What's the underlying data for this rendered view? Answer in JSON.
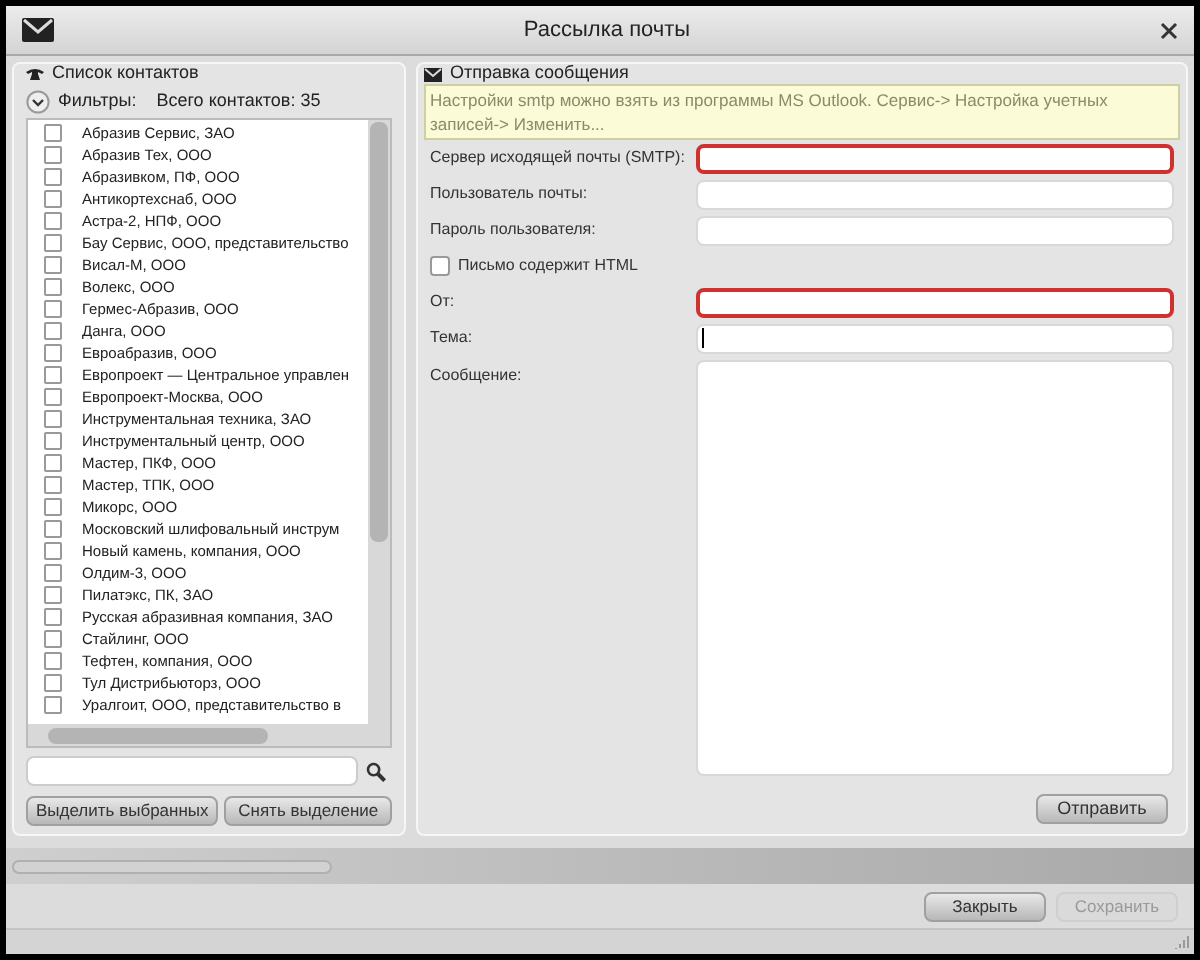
{
  "window": {
    "title": "Рассылка почты"
  },
  "contacts_panel": {
    "title": "Список контактов",
    "filters_label": "Фильтры:",
    "total": "Всего контактов: 35",
    "items": [
      {
        "label": "Абразив Сервис, ЗАО",
        "checked": false
      },
      {
        "label": "Абразив Тех, ООО",
        "checked": false
      },
      {
        "label": "Абразивком, ПФ, ООО",
        "checked": false
      },
      {
        "label": "Антикортехснаб, ООО",
        "checked": false
      },
      {
        "label": "Астра-2, НПФ, ООО",
        "checked": false
      },
      {
        "label": "Бау Сервис, ООО, представительство",
        "checked": false
      },
      {
        "label": "Висал-М, ООО",
        "checked": false
      },
      {
        "label": "Волекс, ООО",
        "checked": false
      },
      {
        "label": "Гермес-Абразив, ООО",
        "checked": false
      },
      {
        "label": "Данга, ООО",
        "checked": false
      },
      {
        "label": "Евроабразив, ООО",
        "checked": false
      },
      {
        "label": "Европроект — Центральное управлен",
        "checked": false
      },
      {
        "label": "Европроект-Москва, ООО",
        "checked": false
      },
      {
        "label": "Инструментальная техника, ЗАО",
        "checked": false
      },
      {
        "label": "Инструментальный центр, ООО",
        "checked": false
      },
      {
        "label": "Мастер, ПКФ, ООО",
        "checked": false
      },
      {
        "label": "Мастер, ТПК, ООО",
        "checked": false
      },
      {
        "label": "Микорс, ООО",
        "checked": false
      },
      {
        "label": "Московский шлифовальный инструм",
        "checked": false
      },
      {
        "label": "Новый камень, компания, ООО",
        "checked": false
      },
      {
        "label": "Олдим-3, ООО",
        "checked": false
      },
      {
        "label": "Пилатэкс, ПК, ЗАО",
        "checked": false
      },
      {
        "label": "Русская абразивная компания, ЗАО",
        "checked": false
      },
      {
        "label": "Стайлинг, ООО",
        "checked": false
      },
      {
        "label": "Тефтен, компания, ООО",
        "checked": false
      },
      {
        "label": "Тул Дистрибьюторз, ООО",
        "checked": false
      },
      {
        "label": "Уралгоит, ООО, представительство в",
        "checked": false
      }
    ],
    "buttons": [
      "Выделить выбранных",
      "Снять выделение"
    ]
  },
  "message_panel": {
    "title": "Отправка сообщения",
    "hint": "Настройки smtp можно взять из программы MS Outlook. Сервис-> Настройка учетных записей-> Изменить...",
    "fields": [
      {
        "kind": "input",
        "label": "Сервер исходящей почты (SMTP):",
        "invalid": true
      },
      {
        "kind": "input",
        "label": "Пользователь почты:",
        "invalid": false
      },
      {
        "kind": "input",
        "label": "Пароль пользователя:",
        "invalid": false
      },
      {
        "kind": "checkbox",
        "label": "Письмо содержит HTML",
        "checked": false
      },
      {
        "kind": "input",
        "label": "От:",
        "invalid": true
      },
      {
        "kind": "input",
        "label": "Тема:",
        "invalid": false,
        "focused": true
      },
      {
        "kind": "textarea",
        "label": "Сообщение:",
        "invalid": false
      }
    ],
    "send_button": "Отправить"
  },
  "progress": {
    "level": 0
  },
  "footer": {
    "buttons": [
      {
        "label": "Закрыть",
        "disabled": false
      },
      {
        "label": "Сохранить",
        "disabled": true
      }
    ]
  }
}
